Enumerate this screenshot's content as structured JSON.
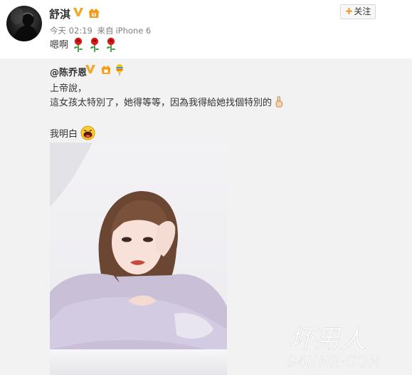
{
  "post": {
    "username": "舒淇",
    "follow_label": "关注",
    "meta": {
      "time": "今天 02:19",
      "source_prefix": "来自",
      "source": "iPhone 6"
    },
    "text": "嗯啊",
    "emoji": [
      "rose-icon",
      "rose-icon",
      "rose-icon"
    ]
  },
  "repost": {
    "author": "@陈乔恩",
    "line1": "上帝說，",
    "line2": "這女孩太特別了，她得等等，因為我得給她找個特別的",
    "line3": "我明白",
    "image_alt": "陈乔恩 photo"
  },
  "watermark": {
    "text_main": "坏男人",
    "text_domain": "94HNR·COM"
  },
  "colors": {
    "accent": "#ff8200",
    "repost_bg": "#f2f2f2",
    "text": "#333333",
    "meta": "#808080"
  }
}
